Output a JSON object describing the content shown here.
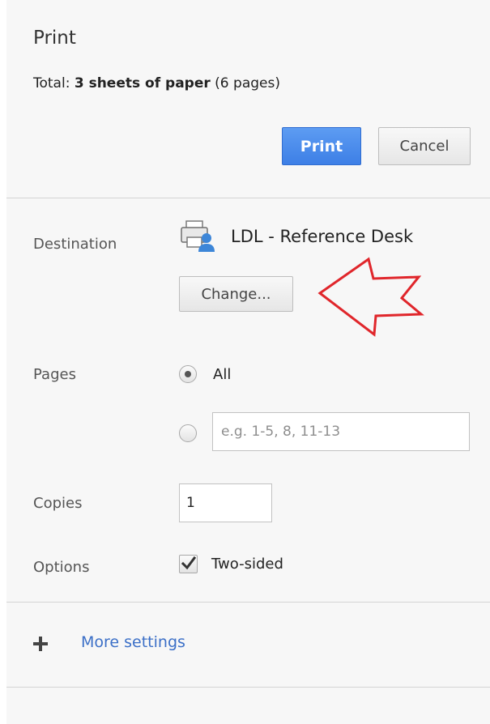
{
  "header": {
    "title": "Print",
    "summary": {
      "prefix": "Total: ",
      "sheets": "3 sheets of paper",
      "pages": " (6 pages)"
    },
    "print_label": "Print",
    "cancel_label": "Cancel"
  },
  "destination": {
    "label": "Destination",
    "printer_name": "LDL - Reference Desk",
    "change_label": "Change...",
    "icon": "printer-user-icon"
  },
  "pages": {
    "label": "Pages",
    "all_label": "All",
    "selected": "all",
    "custom_value": "",
    "custom_placeholder": "e.g. 1-5, 8, 11-13"
  },
  "copies": {
    "label": "Copies",
    "value": "1"
  },
  "options": {
    "label": "Options",
    "two_sided_label": "Two-sided",
    "two_sided_checked": true
  },
  "more_settings": {
    "label": "More settings",
    "icon": "plus-icon"
  },
  "colors": {
    "primary_button": "#4a8af4",
    "link": "#3b6fc7",
    "annotation_arrow": "#e0262b",
    "panel_bg": "#f7f7f7"
  }
}
